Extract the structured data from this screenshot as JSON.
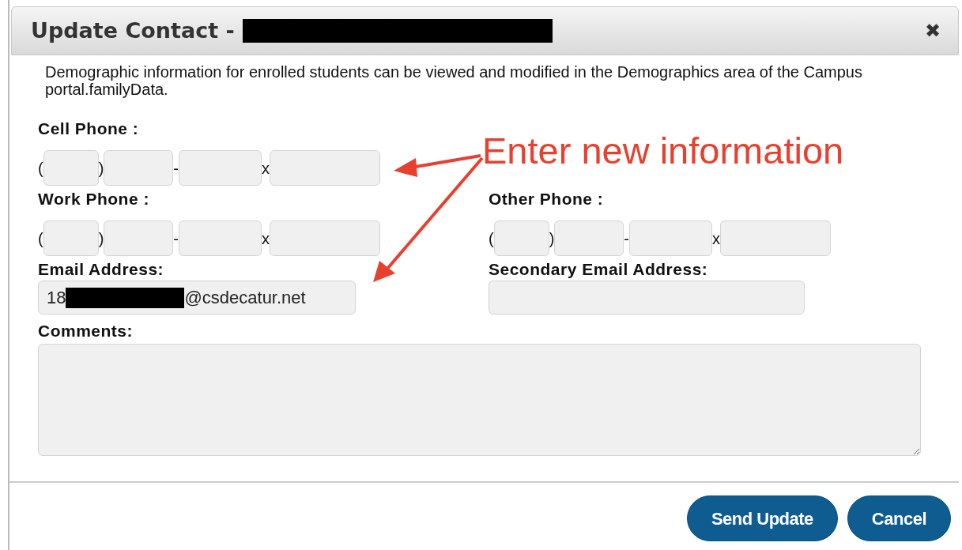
{
  "dialog": {
    "title": "Update Contact -",
    "title_redacted": true,
    "close": "✖"
  },
  "description": "Demographic information for enrolled students can be viewed and modified in the Demographics area of the Campus portal.familyData.",
  "phones": [
    {
      "label": "Cell Phone :",
      "separators": [
        "(",
        ")",
        "-",
        "x"
      ]
    },
    {
      "label": "Work Phone :",
      "separators": [
        "(",
        ")",
        "-",
        "x"
      ]
    },
    {
      "label": "Other Phone :",
      "separators": [
        "(",
        ")",
        "-",
        "x"
      ]
    }
  ],
  "email": {
    "label": "Email Address:",
    "value_start": "18",
    "value_redacted": true,
    "value_end": "@csdecatur.net"
  },
  "secondary_email": {
    "label": "Secondary Email Address:"
  },
  "comments": {
    "label": "Comments:"
  },
  "annotation": {
    "text": "Enter new information"
  },
  "buttons": [
    "Send Update",
    "Cancel"
  ]
}
